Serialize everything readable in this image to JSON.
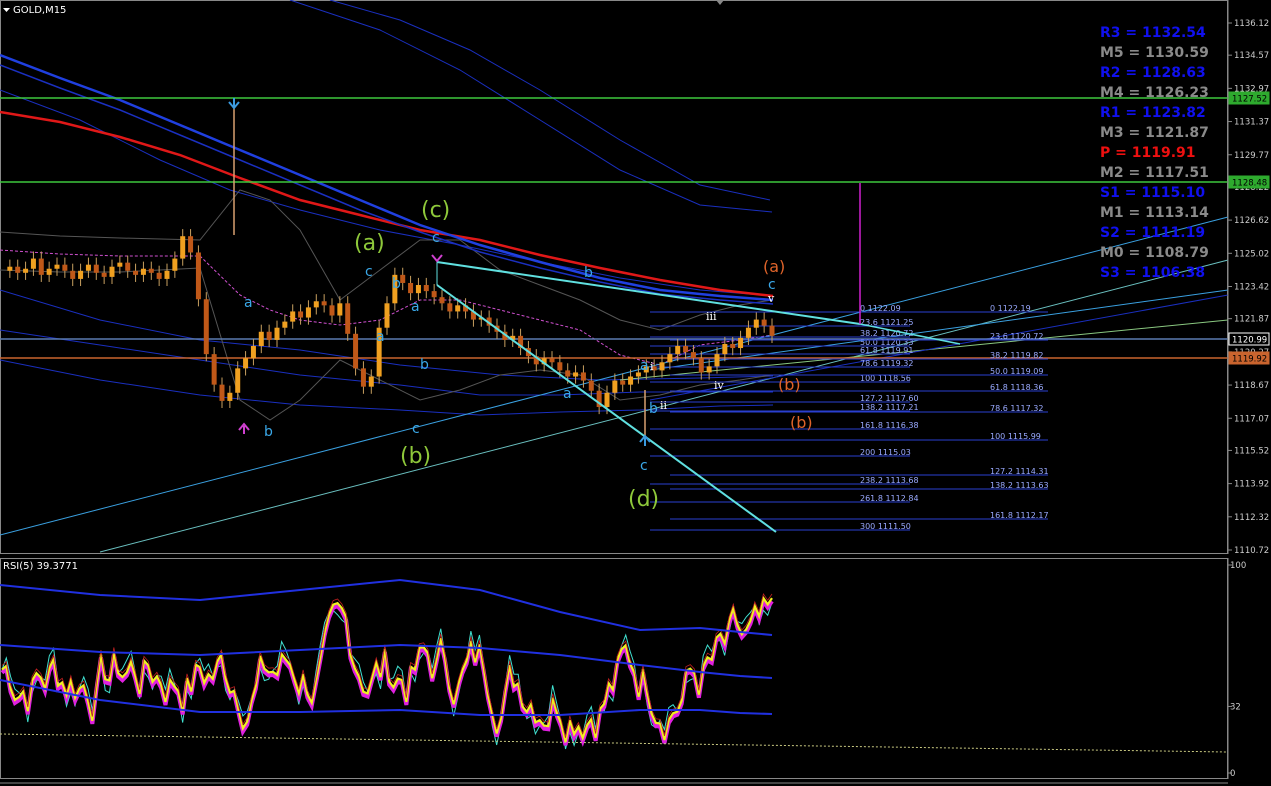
{
  "window": {
    "title": "GOLD,M15"
  },
  "rsi_title": "RSI(5) 39.3771",
  "price_axis": {
    "ticks": [
      "1136.12",
      "1134.57",
      "1132.97",
      "1131.37",
      "1129.77",
      "1128.22",
      "1126.62",
      "1125.02",
      "1123.42",
      "1121.87",
      "1120.27",
      "1118.67",
      "1117.07",
      "1115.52",
      "1113.92",
      "1112.32",
      "1110.72"
    ]
  },
  "price_badges": [
    {
      "text": "1127.52",
      "color": "#2eaa2e"
    },
    {
      "text": "1128.48",
      "color": "#2eaa2e"
    },
    {
      "text": "1120.99",
      "color": "#000000",
      "border": "#ffffff"
    },
    {
      "text": "1119.92",
      "color": "#c9642e"
    }
  ],
  "rsi_axis": {
    "ticks": [
      "100",
      "32",
      "0"
    ]
  },
  "pivots": [
    {
      "text": "R3 = 1132.54",
      "color": "#1010ee"
    },
    {
      "text": "M5 = 1130.59",
      "color": "#8a8a8a"
    },
    {
      "text": "R2 = 1128.63",
      "color": "#1010ee"
    },
    {
      "text": "M4 = 1126.23",
      "color": "#8a8a8a"
    },
    {
      "text": "R1 = 1123.82",
      "color": "#1010ee"
    },
    {
      "text": "M3 = 1121.87",
      "color": "#8a8a8a"
    },
    {
      "text": "P   = 1119.91",
      "color": "#ee1010"
    },
    {
      "text": "M2 = 1117.51",
      "color": "#8a8a8a"
    },
    {
      "text": "S1 = 1115.10",
      "color": "#1010ee"
    },
    {
      "text": "M1 = 1113.14",
      "color": "#8a8a8a"
    },
    {
      "text": "S2 = 1111.19",
      "color": "#1010ee"
    },
    {
      "text": "M0 = 1108.79",
      "color": "#8a8a8a"
    },
    {
      "text": "S3 = 1106.38",
      "color": "#1010ee"
    }
  ],
  "fib_left": [
    "0 1122.09",
    "23.6 1121.25",
    "38.2 1120.72",
    "50.0 1120.33",
    "61.8 1119.91",
    "78.6 1119.32",
    "100 1118.56",
    "127.2 1117.60",
    "138.2 1117.21",
    "161.8 1116.38",
    "200 1115.03",
    "238.2 1113.68",
    "261.8 1112.84",
    "300 1111.50"
  ],
  "fib_right": [
    "0 1122.19",
    "23.6 1120.72",
    "38.2 1119.82",
    "50.0 1119.09",
    "61.8 1118.36",
    "78.6 1117.32",
    "100 1115.99",
    "127.2 1114.31",
    "138.2 1113.63",
    "161.8 1112.17"
  ],
  "wave_labels": {
    "big": [
      "(a)",
      "(c)",
      "(b)",
      "(d)"
    ],
    "small": [
      "a",
      "b",
      "c",
      "b",
      "a",
      "c",
      "b",
      "a",
      "a",
      "b",
      "c",
      "b",
      "a",
      "c",
      "i",
      "iii",
      "ii",
      "iv",
      "v",
      "c"
    ],
    "orange": [
      "(a)",
      "(b)",
      "(b)"
    ]
  },
  "chart_data": {
    "type": "line",
    "title": "GOLD,M15",
    "ylim": [
      1110.72,
      1136.12
    ],
    "series": [
      {
        "name": "GOLD,M15",
        "type": "candlestick"
      },
      {
        "name": "RSI(5)",
        "last": 39.3771
      }
    ],
    "horizontal_levels": [
      1127.52,
      1128.48,
      1120.99,
      1119.92
    ],
    "price_path": [
      1124.6,
      1124.8,
      1124.5,
      1124.7,
      1125.2,
      1124.4,
      1124.7,
      1124.9,
      1124.6,
      1124.2,
      1124.6,
      1124.9,
      1124.5,
      1124.3,
      1124.8,
      1125.0,
      1124.6,
      1124.4,
      1124.7,
      1124.5,
      1124.2,
      1124.6,
      1125.2,
      1126.3,
      1125.5,
      1123.2,
      1120.5,
      1119.0,
      1118.2,
      1118.6,
      1119.8,
      1120.3,
      1120.9,
      1121.6,
      1121.2,
      1121.8,
      1122.1,
      1122.6,
      1122.3,
      1122.8,
      1123.1,
      1122.9,
      1122.4,
      1123.0,
      1121.5,
      1119.8,
      1118.9,
      1119.4,
      1121.8,
      1123.0,
      1124.4,
      1124.0,
      1123.5,
      1123.9,
      1123.6,
      1123.3,
      1123.0,
      1122.6,
      1122.9,
      1122.6,
      1122.2,
      1122.3,
      1121.9,
      1121.6,
      1121.2,
      1121.4,
      1120.8,
      1120.4,
      1120.0,
      1120.3,
      1120.1,
      1119.7,
      1119.4,
      1119.6,
      1119.2,
      1118.7,
      1117.9,
      1118.6,
      1119.2,
      1119.0,
      1119.4,
      1119.6,
      1119.9,
      1119.7,
      1120.1,
      1120.5,
      1120.9,
      1120.6,
      1120.3,
      1119.6,
      1119.9,
      1120.5,
      1121.0,
      1120.8,
      1121.3,
      1121.8,
      1122.2,
      1121.9,
      1121.4
    ]
  }
}
